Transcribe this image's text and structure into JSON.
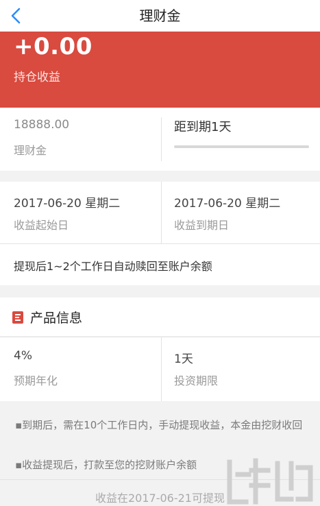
{
  "nav": {
    "title": "理财金",
    "back_icon": "chevron-left-icon"
  },
  "hero": {
    "amount": "+0.00",
    "label": "持仓收益"
  },
  "summary": {
    "principal_value": "18888.00",
    "principal_label": "理财金",
    "countdown": "距到期1天",
    "progress_percent": 0
  },
  "dates": {
    "start_value": "2017-06-20 星期二",
    "start_label": "收益起始日",
    "end_value": "2017-06-20 星期二",
    "end_label": "收益到期日"
  },
  "redeem_note": "提现后1~2个工作日自动赎回至账户余额",
  "product": {
    "title": "产品信息",
    "rate_value": "4%",
    "rate_label": "预期年化",
    "term_value": "1天",
    "term_label": "投资期限"
  },
  "bullets": [
    "▪到期后，需在10个工作日内，手动提现收益，本金由挖财收回",
    "▪收益提现后，打款至您的挖财账户余额"
  ],
  "footer": {
    "text": "收益在2017-06-21可提现"
  },
  "colors": {
    "accent": "#d94a3f",
    "back": "#2a8cff"
  }
}
